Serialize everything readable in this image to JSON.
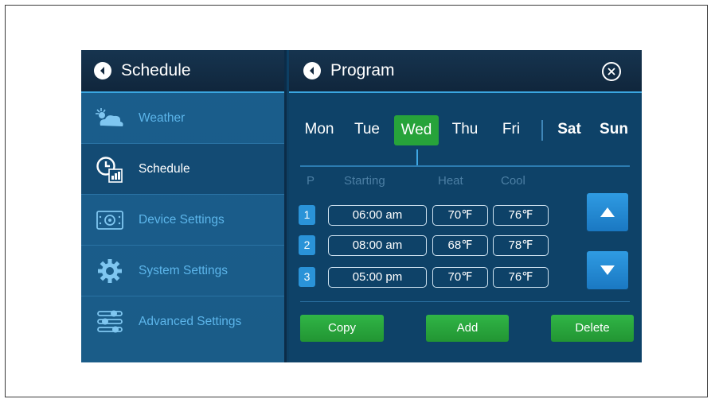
{
  "sidebar": {
    "title": "Schedule",
    "items": [
      {
        "label": "Weather"
      },
      {
        "label": "Schedule"
      },
      {
        "label": "Device Settings"
      },
      {
        "label": "System Settings"
      },
      {
        "label": "Advanced Settings"
      }
    ]
  },
  "main": {
    "title": "Program",
    "days": [
      "Mon",
      "Tue",
      "Wed",
      "Thu",
      "Fri",
      "Sat",
      "Sun"
    ],
    "selected_day": "Wed",
    "columns": [
      "P",
      "Starting",
      "Heat",
      "Cool"
    ],
    "rows": [
      {
        "num": "1",
        "start": "06:00 am",
        "heat": "70℉",
        "cool": "76℉"
      },
      {
        "num": "2",
        "start": "08:00 am",
        "heat": "68℉",
        "cool": "78℉"
      },
      {
        "num": "3",
        "start": "05:00 pm",
        "heat": "70℉",
        "cool": "76℉"
      }
    ],
    "buttons": {
      "copy": "Copy",
      "add": "Add",
      "delete": "Delete"
    }
  },
  "colors": {
    "accent_green": "#27a33a",
    "accent_blue": "#2a93d8",
    "panel": "#0e4268"
  }
}
